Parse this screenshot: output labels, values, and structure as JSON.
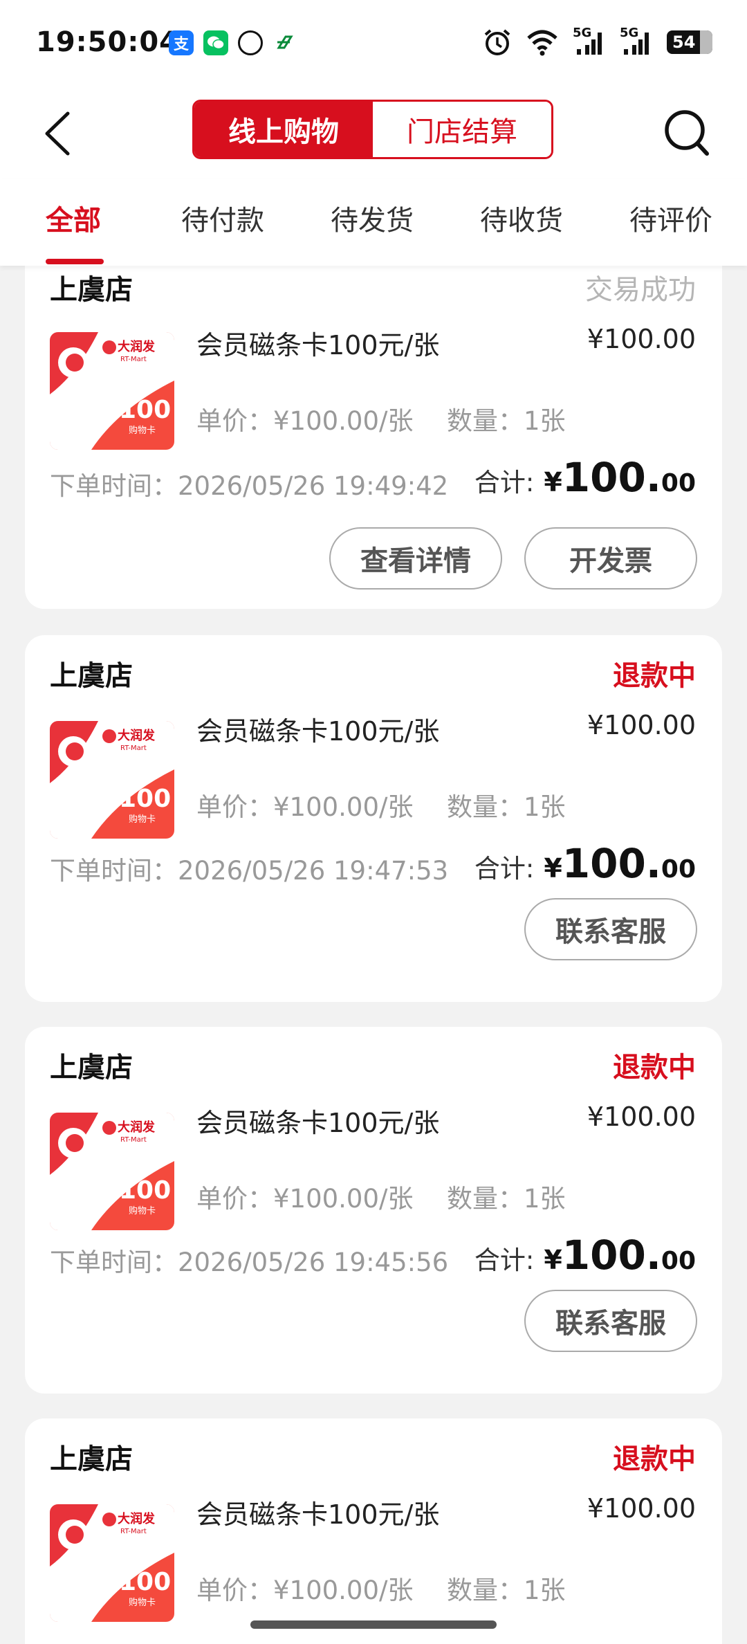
{
  "status_bar": {
    "time": "19:50:04",
    "network_1": "5G",
    "network_2": "5G",
    "battery": "54"
  },
  "header": {
    "tab_online": "线上购物",
    "tab_store": "门店结算"
  },
  "tabs": [
    {
      "label": "全部"
    },
    {
      "label": "待付款"
    },
    {
      "label": "待发货"
    },
    {
      "label": "待收货"
    },
    {
      "label": "待评价"
    }
  ],
  "colors": {
    "accent": "#d70f1e",
    "muted": "#999999"
  },
  "thumb": {
    "brand": "大润发",
    "sub": "RT-Mart",
    "amount": "100",
    "card_label": "购物卡",
    "currency": "¥"
  },
  "orders": [
    {
      "store": "上虞店",
      "status": "交易成功",
      "product": "会员磁条卡100元/张",
      "price": "¥100.00",
      "unit_price": "单价：¥100.00/张",
      "quantity": "数量：1张",
      "order_time": "下单时间：2026/05/26 19:49:42",
      "total_label": "合计:",
      "total_currency": "¥",
      "total_int": "100.",
      "total_dec": "00",
      "buttons": [
        "查看详情",
        "开发票"
      ]
    },
    {
      "store": "上虞店",
      "status": "退款中",
      "product": "会员磁条卡100元/张",
      "price": "¥100.00",
      "unit_price": "单价：¥100.00/张",
      "quantity": "数量：1张",
      "order_time": "下单时间：2026/05/26 19:47:53",
      "total_label": "合计:",
      "total_currency": "¥",
      "total_int": "100.",
      "total_dec": "00",
      "buttons": [
        "联系客服"
      ]
    },
    {
      "store": "上虞店",
      "status": "退款中",
      "product": "会员磁条卡100元/张",
      "price": "¥100.00",
      "unit_price": "单价：¥100.00/张",
      "quantity": "数量：1张",
      "order_time": "下单时间：2026/05/26 19:45:56",
      "total_label": "合计:",
      "total_currency": "¥",
      "total_int": "100.",
      "total_dec": "00",
      "buttons": [
        "联系客服"
      ]
    },
    {
      "store": "上虞店",
      "status": "退款中",
      "product": "会员磁条卡100元/张",
      "price": "¥100.00",
      "unit_price": "单价：¥100.00/张",
      "quantity": "数量：1张"
    }
  ]
}
